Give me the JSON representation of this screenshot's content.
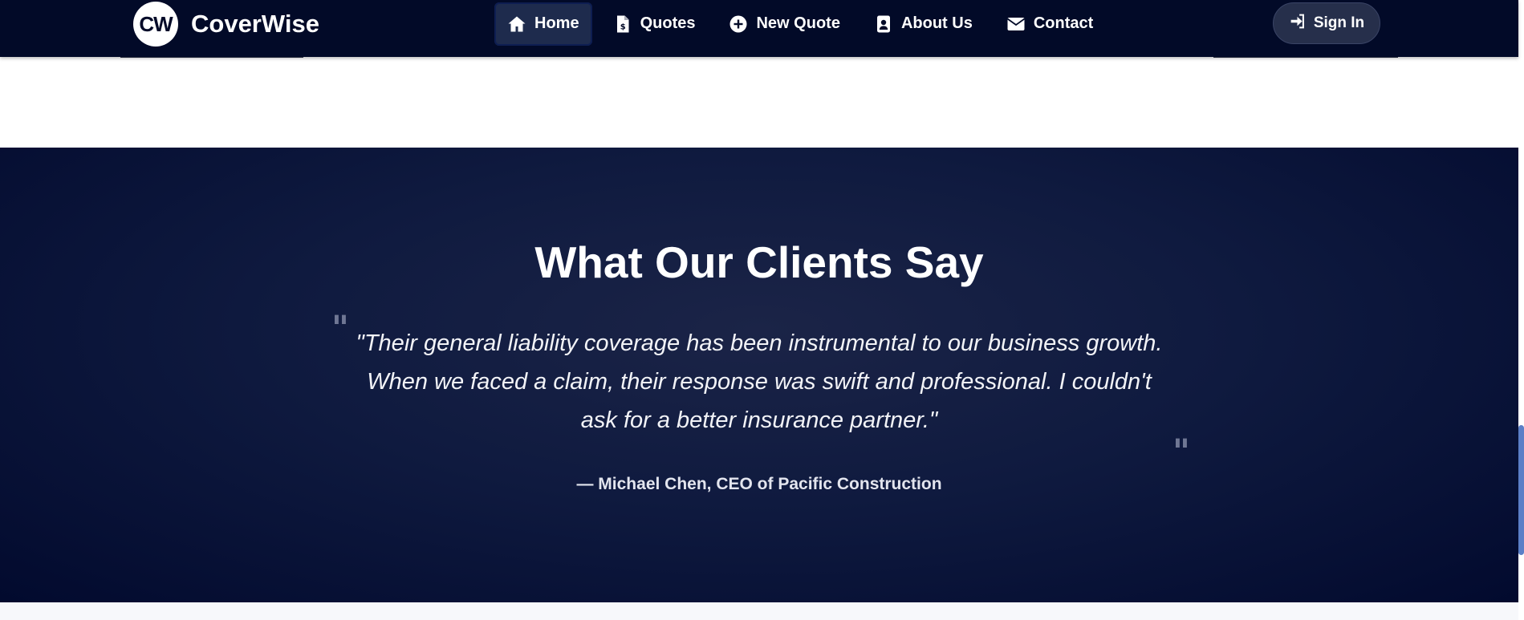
{
  "brand": {
    "logo_text": "CW",
    "name": "CoverWise"
  },
  "nav": {
    "items": [
      {
        "label": "Home",
        "icon": "home-icon",
        "active": true
      },
      {
        "label": "Quotes",
        "icon": "invoice-dollar-icon",
        "active": false
      },
      {
        "label": "New Quote",
        "icon": "plus-circle-icon",
        "active": false
      },
      {
        "label": "About Us",
        "icon": "id-badge-icon",
        "active": false
      },
      {
        "label": "Contact",
        "icon": "envelope-icon",
        "active": false
      }
    ],
    "signin_label": "Sign In",
    "signin_icon": "sign-in-icon"
  },
  "testimonials": {
    "title": "What Our Clients Say",
    "quote": "\"Their general liability coverage has been instrumental to our business growth. When we faced a claim, their response was swift and professional. I couldn't ask for a better insurance partner.\"",
    "author": "— Michael Chen, CEO of Pacific Construction",
    "open_mark": "\"",
    "close_mark": "\""
  },
  "colors": {
    "navbar_bg": "#020a28",
    "section_bg": "#0f1a3f",
    "active_nav_bg": "#1e2b4d",
    "scroll_thumb": "#5b7fc7"
  }
}
